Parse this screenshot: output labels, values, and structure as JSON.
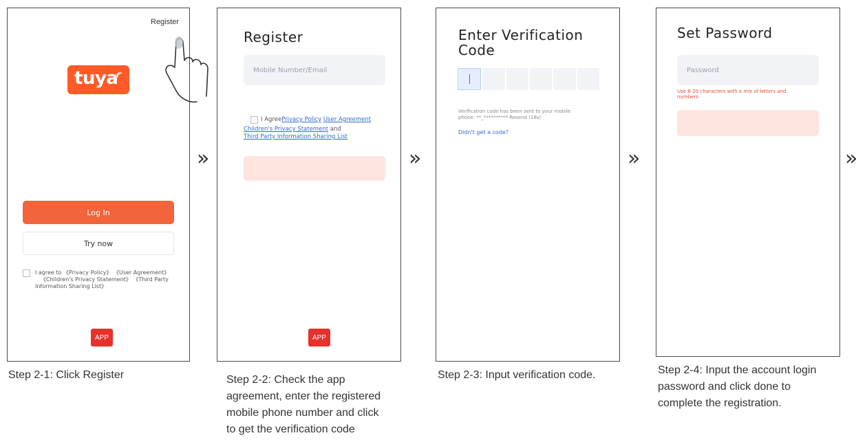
{
  "screen1": {
    "register_link": "Register",
    "logo": "tuya",
    "login_button": "Log In",
    "try_button": "Try now",
    "agree_line1": "I agree to 《Privacy Policy》 《User Agreement》",
    "agree_line2": "《Children's Privacy Statement》 《Third Party",
    "agree_line3": "Information Sharing List》",
    "app_badge": "APP",
    "caption": "Step 2-1: Click Register"
  },
  "screen2": {
    "title": "Register",
    "input_placeholder": "Mobile Number/Email",
    "agree_prefix": "I Agree",
    "privacy_policy": "Privacy Policy",
    "user_agreement": "User Agreement",
    "childrens_statement": "Children's Privacy Statement",
    "and_text": " and",
    "third_party": "Third Party Information Sharing List",
    "app_badge": "APP",
    "caption_line1": "Step 2-2: Check the app",
    "caption_line2": "agreement, enter the registered",
    "caption_line3": "mobile phone number and click",
    "caption_line4": "to get the verification code"
  },
  "screen3": {
    "title_line1": "Enter Verification",
    "title_line2": "Code",
    "sent_line1": "Verification code has been sent to your mobile",
    "sent_line2": "phone:  **_**********  Resend (18s)",
    "didnt_get": "Didn't get a code?",
    "caption": "Step 2-3: Input verification code."
  },
  "screen4": {
    "title": "Set Password",
    "input_placeholder": "Password",
    "hint_line1": "Use 6-20 characters with a mix of letters and",
    "hint_line2": "numbers",
    "caption_line1": "Step 2-4: Input  the account login",
    "caption_line2": "password and click done to",
    "caption_line3": "complete the registration."
  },
  "separator": "»",
  "colors": {
    "brand": "#ff5a28",
    "login_button": "#f2643c",
    "disabled_button": "#fde4df",
    "link": "#2e6bd6",
    "warning": "#e8452c",
    "app_badge": "#e5322d"
  },
  "icons": {
    "hand": "pointing-hand-icon",
    "chevron": "double-chevron-right-icon"
  }
}
